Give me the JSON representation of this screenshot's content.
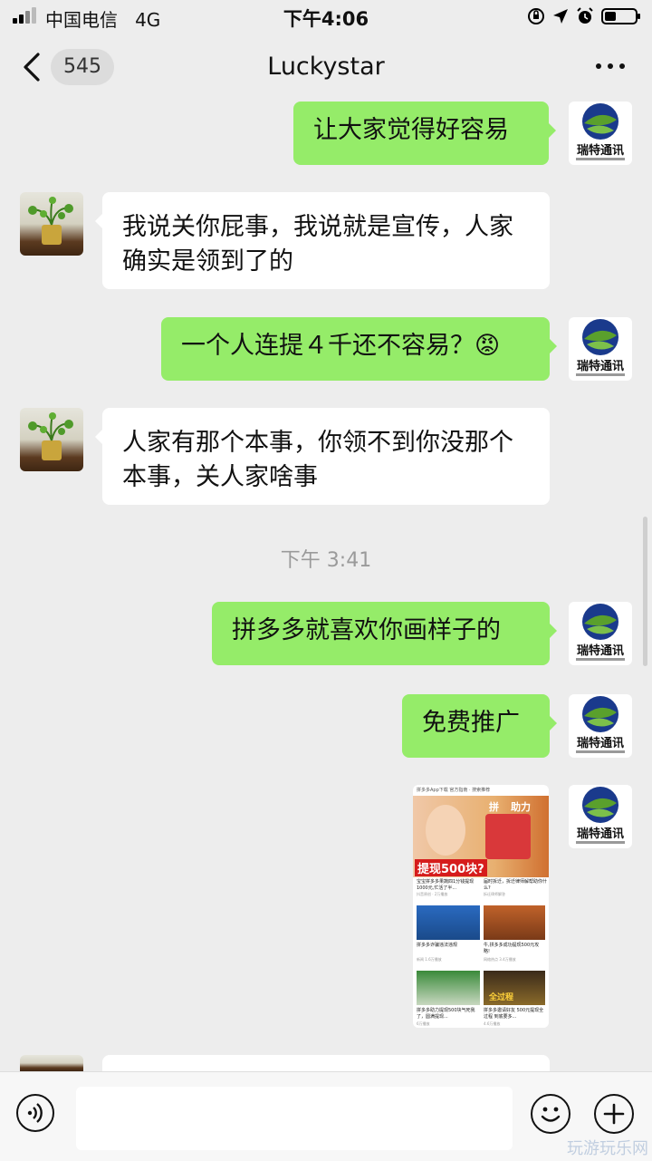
{
  "status_bar": {
    "carrier": "中国电信",
    "network": "4G",
    "time": "下午4:06"
  },
  "nav": {
    "unread_count": "545",
    "title": "Luckystar"
  },
  "messages": [
    {
      "sender": "me",
      "text": "让大家觉得好容易"
    },
    {
      "sender": "them",
      "text": "我说关你屁事，我说就是宣传，人家确实是领到了的"
    },
    {
      "sender": "me",
      "text": "一个人连提４千还不容易？",
      "emoji": "😡"
    },
    {
      "sender": "them",
      "text": "人家有那个本事，你领不到你没那个本事，关人家啥事"
    },
    {
      "sender": "me",
      "text": "拼多多就喜欢你画样子的"
    },
    {
      "sender": "me",
      "text": "免费推广"
    }
  ],
  "timestamp": "下午 3:41",
  "avatar_logo_text": "瑞特通讯",
  "shared_image": {
    "top_caption": "拼多多App下载 官方指南 · 搜索推荐",
    "banner_tags": [
      "拼",
      "助力"
    ],
    "banner_caption": "提现500块?",
    "cards": [
      {
        "text": "宝宝拼多多果蔬四1分钱提现1000元,忙活了半...",
        "meta": "抖音原创 · 2万播放"
      },
      {
        "text": "届时拆迁，拆迁律师解帮助你什么?",
        "meta": "拆迁律师解答"
      },
      {
        "text": "拼多多诈骗违法违规",
        "meta": "新闻 1.6万播放"
      },
      {
        "text": "牛,拼多多成功提现500元攻略!",
        "meta": "网络热点 3.4万播放"
      },
      {
        "text": "拼多多助力提现500块气死我了，圆满提现...",
        "meta": "6万播放"
      },
      {
        "text": "拼多多邀请好友 500元提现全过程 到底要多...",
        "meta": "4.6万播放"
      }
    ],
    "thumb_labels": [
      "全过程"
    ]
  },
  "watermark": "玩游玩乐网",
  "colors": {
    "bg": "#ededed",
    "my_bubble": "#95ec69",
    "their_bubble": "#ffffff",
    "logo_blue": "#1a3a8c",
    "logo_green": "#5aa02c"
  }
}
